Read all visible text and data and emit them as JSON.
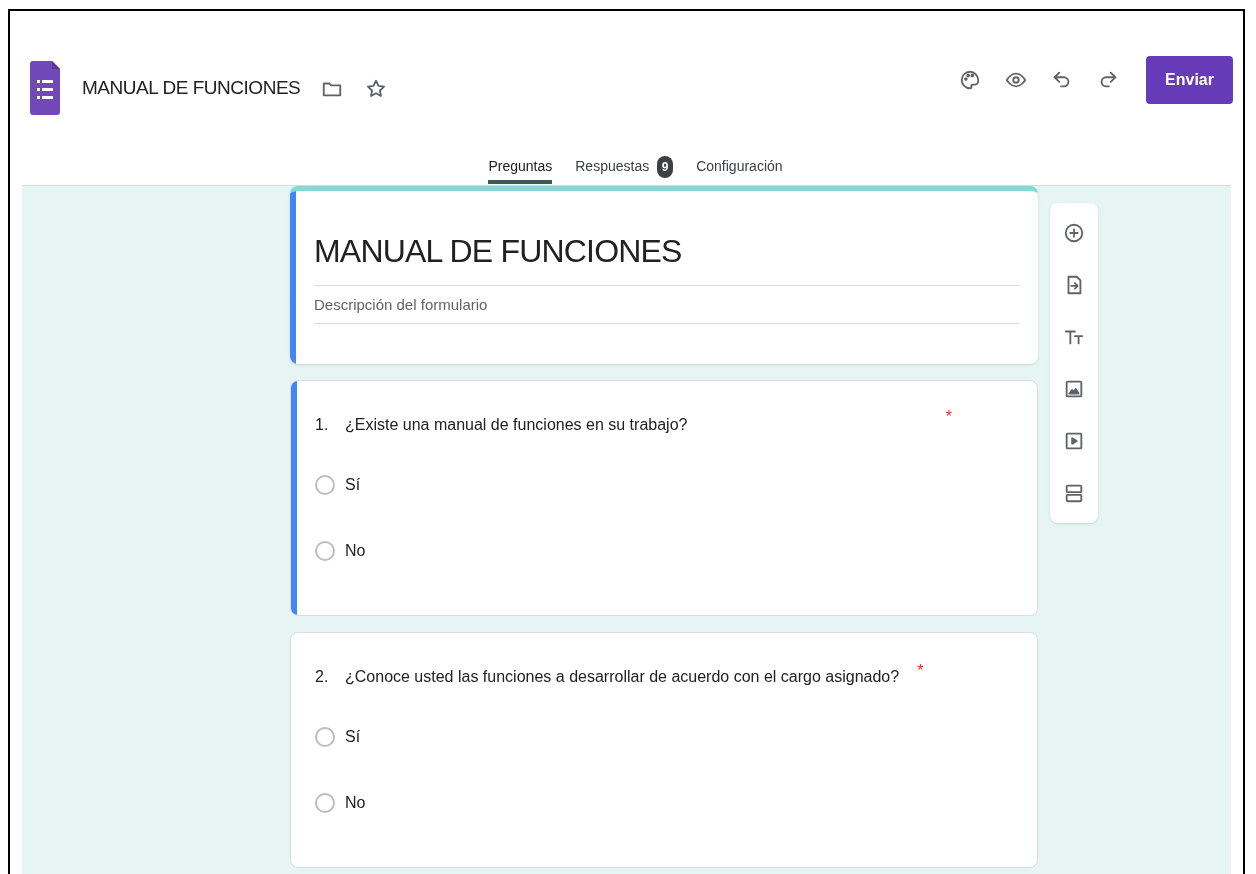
{
  "header": {
    "title": "MANUAL DE FUNCIONES",
    "send_button": "Enviar"
  },
  "tabs": [
    {
      "label": "Preguntas",
      "selected": true
    },
    {
      "label": "Respuestas",
      "badge": "9",
      "selected": false
    },
    {
      "label": "Configuración",
      "selected": false
    }
  ],
  "form_header": {
    "title": "MANUAL DE FUNCIONES",
    "description_placeholder": "Descripción del formulario",
    "focused": true
  },
  "questions": [
    {
      "number": "1.",
      "text": "¿Existe una manual de funciones en su trabajo?",
      "required_mark": "*",
      "focused": true,
      "options": [
        {
          "label": "Sí",
          "selected": false
        },
        {
          "label": "No",
          "selected": false
        }
      ]
    },
    {
      "number": "2.",
      "text": "¿Conoce usted las funciones a desarrollar de acuerdo con el cargo asignado?",
      "required_mark": "*",
      "focused": false,
      "options": [
        {
          "label": "Sí",
          "selected": false
        },
        {
          "label": "No",
          "selected": false
        }
      ]
    }
  ]
}
